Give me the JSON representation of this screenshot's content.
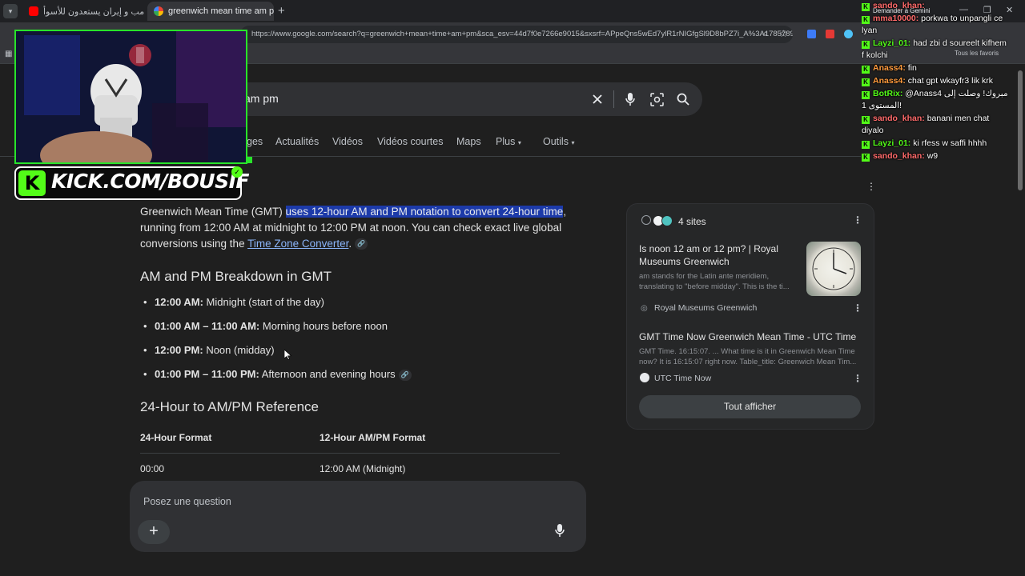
{
  "browser": {
    "tabs": [
      {
        "title": "ترامب و إيران يستعدون للأسوأ - ...",
        "active": false
      },
      {
        "title": "greenwich mean time am pm -",
        "active": true
      }
    ],
    "new_tab": "+",
    "close": "✕",
    "url": "https://www.google.com/search?q=greenwich+mean+time+am+pm&sca_esv=44d7f0e7266e9015&sxsrf=APpeQns5wEd7ylR1rNIGfgSl9D8bPZ7i_A%3A1785789215606&ei=H_twaOZJKb97_UPvtihsQo&biw=1536...",
    "bookmarks_right": "Tous les favoris",
    "gemini": "Demander à Gemini"
  },
  "search": {
    "query_visible": "am pm",
    "tabs": [
      "ges",
      "Actualités",
      "Vidéos",
      "Vidéos courtes",
      "Maps",
      "Plus",
      "Outils"
    ]
  },
  "answer": {
    "intro_pre": "Greenwich Mean Time (GMT) ",
    "intro_highlight": "uses 12-hour AM and PM notation to convert 24-hour time",
    "intro_post": ", running from 12:00 AM at midnight to 12:00 PM at noon. You can check exact live global conversions using the ",
    "intro_link": "Time Zone Converter",
    "intro_end": ".",
    "h_breakdown": "AM and PM Breakdown in GMT",
    "bullets": [
      {
        "bold": "12:00 AM:",
        "text": " Midnight (start of the day)"
      },
      {
        "bold": "01:00 AM – 11:00 AM:",
        "text": " Morning hours before noon"
      },
      {
        "bold": "12:00 PM:",
        "text": " Noon (midday)"
      },
      {
        "bold": "01:00 PM – 11:00 PM:",
        "text": " Afternoon and evening hours"
      }
    ],
    "h_reference": "24-Hour to AM/PM Reference",
    "table": {
      "headers": [
        "24-Hour Format",
        "12-Hour AM/PM Format"
      ],
      "rows": [
        [
          "00:00",
          "12:00 AM (Midnight)"
        ]
      ]
    }
  },
  "ask": {
    "placeholder": "Posez une question",
    "plus": "+"
  },
  "sources": {
    "count_label": "4 sites",
    "items": [
      {
        "title": "Is noon 12 am or 12 pm? | Royal Museums Greenwich",
        "snippet1": "am stands for the Latin ante meridiem,",
        "snippet2": "translating to \"before midday\". This is the ti...",
        "site": "Royal Museums Greenwich"
      },
      {
        "title": "GMT Time Now Greenwich Mean Time - UTC Time",
        "snippet1": "GMT Time. 16:15:07. ... What time is it in Greenwich Mean Time",
        "snippet2": "now? It is 16:15:07 right now. Table_title: Greenwich Mean Tim...",
        "site": "UTC Time Now"
      }
    ],
    "show_all": "Tout afficher"
  },
  "overlay": {
    "kick_text": "KICK.COM/BOUSIF",
    "kick_logo": "K"
  },
  "chat": [
    {
      "user": "sando_khan",
      "color": "#ff6a6a",
      "msg": ""
    },
    {
      "user": "mma10000",
      "color": "#ff6a6a",
      "msg": "porkwa to unpangli ce lyan"
    },
    {
      "user": "Layzi_01",
      "color": "#53fc18",
      "msg": "had zbi d soureelt kifhem f kolchi"
    },
    {
      "user": "Anass4",
      "color": "#ff9a3c",
      "msg": "fin"
    },
    {
      "user": "Anass4",
      "color": "#ff9a3c",
      "msg": "chat gpt wkayfr3 lik krk"
    },
    {
      "user": "BotRix",
      "color": "#53fc18",
      "msg": "@Anass4 مبروك! وصلت إلى المستوى 1!"
    },
    {
      "user": "sando_khan",
      "color": "#ff6a6a",
      "msg": "banani men chat diyalo"
    },
    {
      "user": "Layzi_01",
      "color": "#53fc18",
      "msg": "ki rfess w saffi hhhh"
    },
    {
      "user": "sando_khan",
      "color": "#ff6a6a",
      "msg": "w9"
    }
  ]
}
